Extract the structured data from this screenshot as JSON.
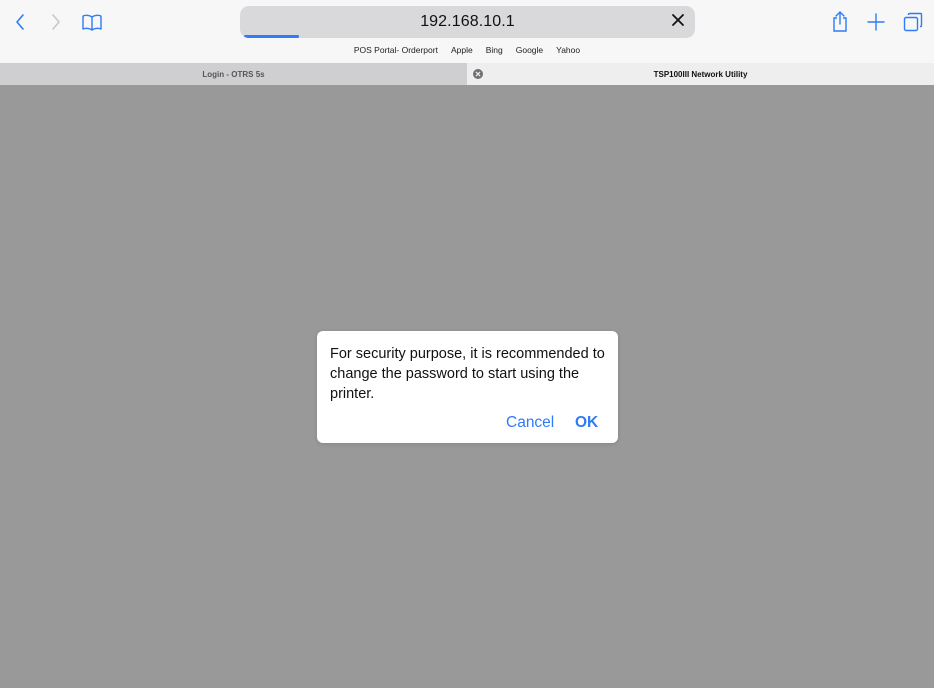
{
  "toolbar": {
    "address": "192.168.10.1",
    "load_progress": 0.12,
    "icons": {
      "back": "chevron-left-icon",
      "forward": "chevron-right-icon",
      "bookmarks": "book-icon",
      "stop": "close-icon",
      "share": "share-icon",
      "new_tab": "plus-icon",
      "tabs": "tabs-overview-icon"
    }
  },
  "favorites": [
    "POS Portal- Orderport",
    "Apple",
    "Bing",
    "Google",
    "Yahoo"
  ],
  "tabs": [
    {
      "label": "Login - OTRS 5s",
      "active": false
    },
    {
      "label": "TSP100III Network Utility",
      "active": true
    }
  ],
  "dialog": {
    "message": "For security purpose, it is recommended to change the password to start using the printer.",
    "cancel_label": "Cancel",
    "ok_label": "OK"
  },
  "colors": {
    "accent": "#2f7cf6",
    "page_background": "#999999",
    "toolbar_background": "#f7f7f7"
  }
}
